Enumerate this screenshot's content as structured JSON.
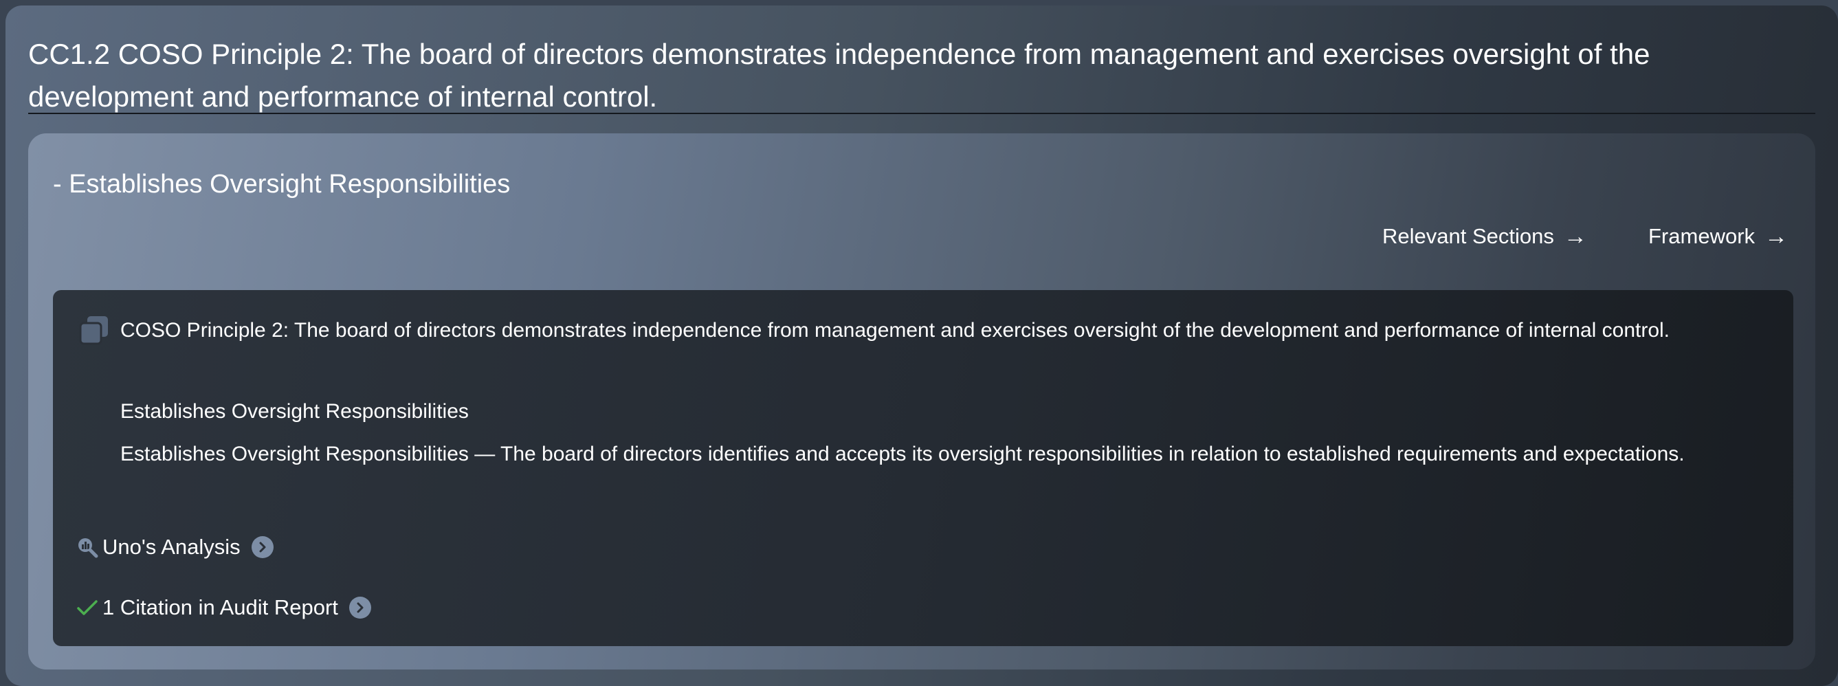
{
  "page": {
    "title": "CC1.2 COSO Principle 2: The board of directors demonstrates independence from management and exercises oversight of the development and performance of internal control."
  },
  "card": {
    "heading": "- Establishes Oversight Responsibilities",
    "links": {
      "relevant_sections": "Relevant Sections",
      "framework": "Framework",
      "arrow": "→"
    },
    "content": {
      "principle": "COSO Principle 2: The board of directors demonstrates independence from management and exercises oversight of the development and performance of internal control.",
      "point_of_focus": "Establishes Oversight Responsibilities",
      "description": "Establishes Oversight Responsibilities — The board of directors identifies and accepts its oversight responsibilities in relation to established requirements and expectations."
    },
    "actions": {
      "analysis_label": "Uno's Analysis",
      "citation_label": "1 Citation in Audit Report"
    }
  },
  "icons": {
    "copy": "copy-icon",
    "analysis": "magnify-chart-icon",
    "check": "check-icon",
    "chevron": "chevron-right-circle-icon",
    "arrow": "arrow-right-icon"
  },
  "colors": {
    "check_green": "#4caf50",
    "chevron_circle": "#7d8ea6",
    "text": "#ffffff"
  }
}
